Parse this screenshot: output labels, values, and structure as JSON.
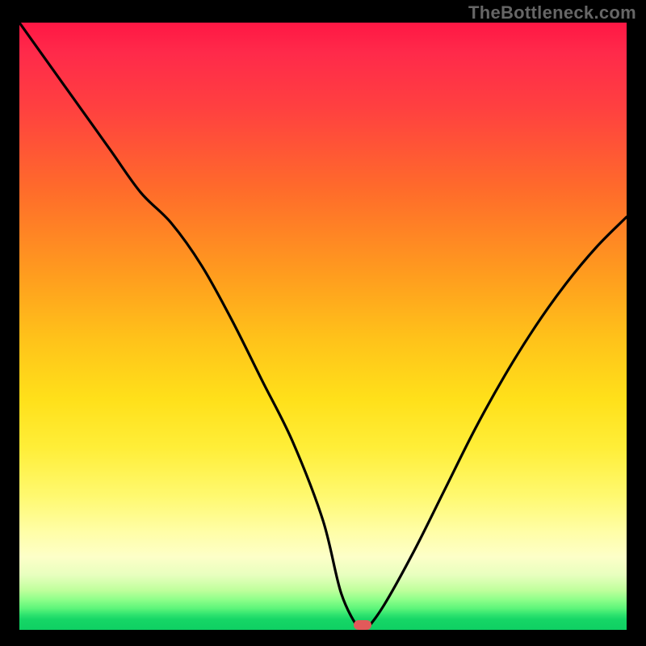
{
  "watermark": "TheBottleneck.com",
  "chart_data": {
    "type": "line",
    "title": "",
    "xlabel": "",
    "ylabel": "",
    "xlim": [
      0,
      100
    ],
    "ylim": [
      0,
      100
    ],
    "x": [
      0,
      5,
      10,
      15,
      20,
      25,
      30,
      35,
      40,
      45,
      50,
      53,
      56,
      57,
      60,
      65,
      70,
      75,
      80,
      85,
      90,
      95,
      100
    ],
    "values": [
      100,
      93,
      86,
      79,
      72,
      67,
      60,
      51,
      41,
      31,
      18,
      6,
      0,
      0,
      4,
      13,
      23,
      33,
      42,
      50,
      57,
      63,
      68
    ],
    "marker": {
      "x": 56.5,
      "y": 0
    },
    "background": "rainbow-gradient"
  }
}
